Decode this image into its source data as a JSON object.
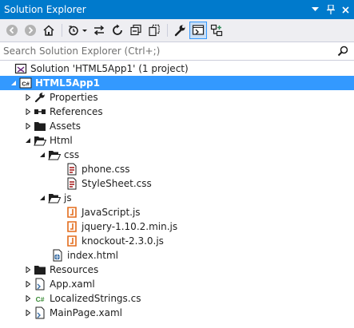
{
  "titlebar": {
    "title": "Solution Explorer"
  },
  "search": {
    "placeholder": "Search Solution Explorer (Ctrl+;)"
  },
  "tree": {
    "solution": "Solution 'HTML5App1' (1 project)",
    "project": "HTML5App1",
    "project_badge": "C#",
    "properties": "Properties",
    "references": "References",
    "assets": "Assets",
    "html": "Html",
    "css": "css",
    "phone_css": "phone.css",
    "stylesheet_css": "StyleSheet.css",
    "js": "js",
    "javascript_js": "JavaScript.js",
    "jquery_js": "jquery-1.10.2.min.js",
    "knockout_js": "knockout-2.3.0.js",
    "index_html": "index.html",
    "resources": "Resources",
    "app_xaml": "App.xaml",
    "localized_strings": "LocalizedStrings.cs",
    "localized_badge": "C#",
    "mainpage_xaml": "MainPage.xaml"
  },
  "colors": {
    "accent": "#007acc",
    "selection": "#3399ff",
    "toolbar_bg": "#eeeef2",
    "folder": "#1e1e1e",
    "js_icon": "#e36c1c",
    "css_icon": "#a31515"
  }
}
